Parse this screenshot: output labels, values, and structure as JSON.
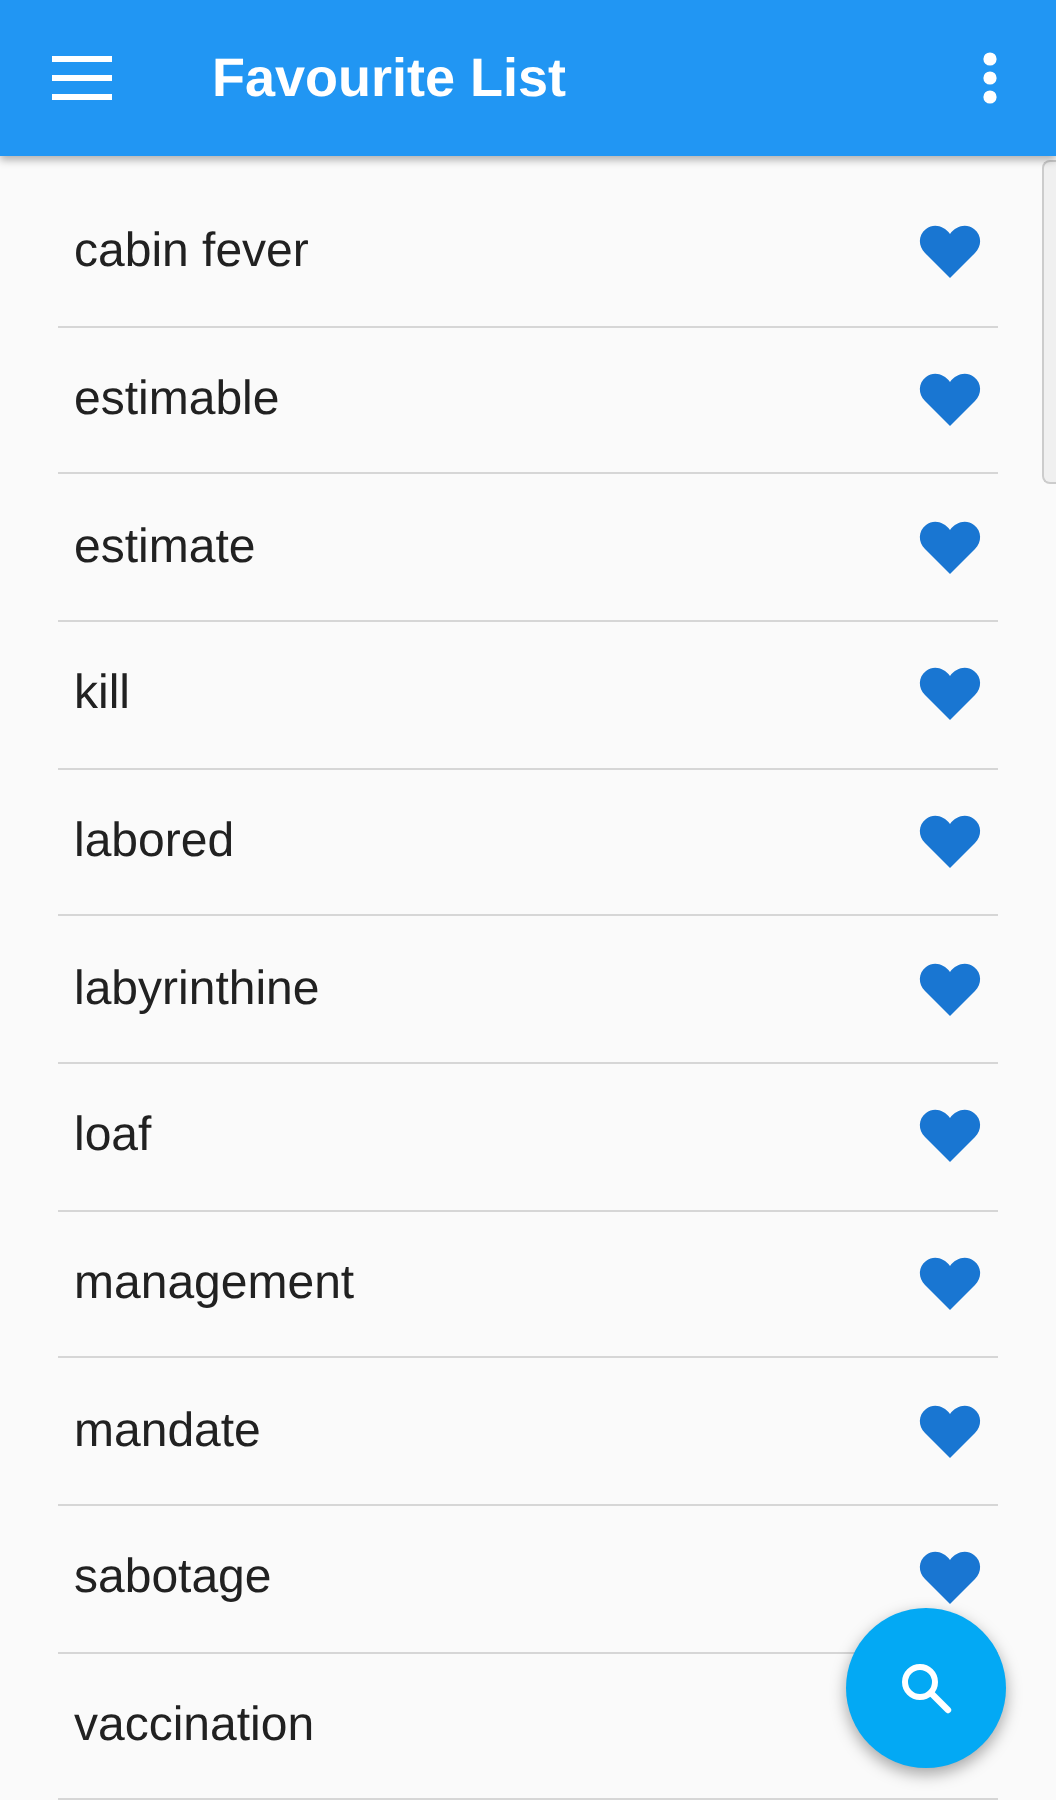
{
  "app_bar": {
    "title": "Favourite List"
  },
  "words": [
    {
      "label": "cabin fever",
      "favourite": true
    },
    {
      "label": "estimable",
      "favourite": true
    },
    {
      "label": "estimate",
      "favourite": true
    },
    {
      "label": "kill",
      "favourite": true
    },
    {
      "label": "labored",
      "favourite": true
    },
    {
      "label": "labyrinthine",
      "favourite": true
    },
    {
      "label": "loaf",
      "favourite": true
    },
    {
      "label": "management",
      "favourite": true
    },
    {
      "label": "mandate",
      "favourite": true
    },
    {
      "label": "sabotage",
      "favourite": true
    },
    {
      "label": "vaccination"
    }
  ]
}
